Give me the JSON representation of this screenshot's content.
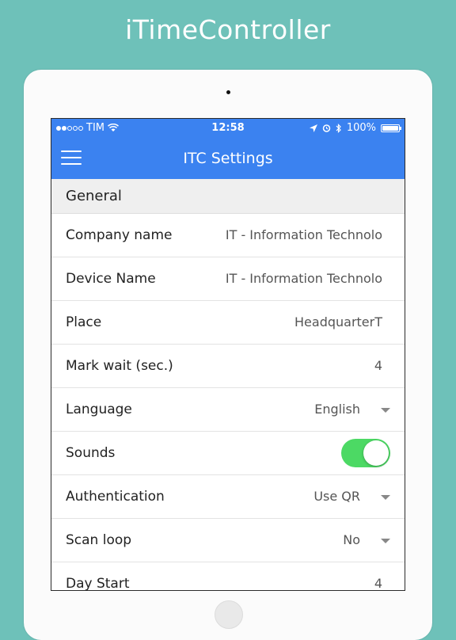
{
  "promo": {
    "title": "iTimeController"
  },
  "status_bar": {
    "carrier": "TIM",
    "time": "12:58",
    "battery": "100%",
    "signal_dots_filled": 2,
    "signal_dots_total": 5
  },
  "header": {
    "title": "ITC Settings",
    "menu_icon": "hamburger-menu-icon",
    "bg_color": "#3b82f0"
  },
  "section": {
    "title": "General"
  },
  "rows": [
    {
      "label": "Company name",
      "value": "IT - Information Technolo",
      "type": "text"
    },
    {
      "label": "Device Name",
      "value": "IT - Information Technolo",
      "type": "text"
    },
    {
      "label": "Place",
      "value": "HeadquarterT",
      "type": "text"
    },
    {
      "label": "Mark wait (sec.)",
      "value": "4",
      "type": "number"
    },
    {
      "label": "Language",
      "value": "English",
      "type": "select"
    },
    {
      "label": "Sounds",
      "value": "on",
      "type": "toggle"
    },
    {
      "label": "Authentication",
      "value": "Use QR",
      "type": "select"
    },
    {
      "label": "Scan loop",
      "value": "No",
      "type": "select"
    },
    {
      "label": "Day Start",
      "value": "4",
      "type": "number"
    }
  ],
  "colors": {
    "background": "#6ec1b9",
    "toggle_on": "#4cd964"
  }
}
